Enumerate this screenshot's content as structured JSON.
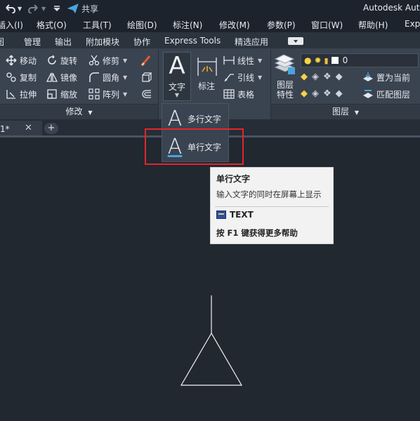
{
  "title_bar": {
    "share_label": "共享",
    "app_title": "Autodesk Auto"
  },
  "menu": {
    "items": [
      "插入(I)",
      "格式(O)",
      "工具(T)",
      "绘图(D)",
      "标注(N)",
      "修改(M)",
      "参数(P)",
      "窗口(W)",
      "帮助(H)",
      "Exp"
    ]
  },
  "ribbon_tabs": [
    "图",
    "管理",
    "输出",
    "附加模块",
    "协作",
    "Express Tools",
    "精选应用"
  ],
  "modify_panel": {
    "title": "修改",
    "tools": [
      "移动",
      "旋转",
      "修剪",
      "复制",
      "镜像",
      "圆角",
      "拉伸",
      "缩放",
      "阵列"
    ]
  },
  "annotation_panel": {
    "text_label": "文字",
    "dimension_label": "标注",
    "linear_label": "线性",
    "leader_label": "引线",
    "table_label": "表格"
  },
  "layers_panel": {
    "title": "图层",
    "properties_label": "图层\n特性",
    "current_layer": "0",
    "set_current_label": "置为当前",
    "match_layer_label": "匹配图层"
  },
  "text_dropdown": {
    "mtext_label": "多行文字",
    "single_text_label": "单行文字",
    "glyph": "A"
  },
  "doc_tabs": {
    "active_label": "1*",
    "close_glyph": "✕",
    "add_glyph": "+"
  },
  "tooltip": {
    "title": "单行文字",
    "description": "输入文字的同时在屏幕上显示",
    "command": "TEXT",
    "help": "按 F1 键获得更多帮助"
  },
  "colors": {
    "highlight": "#e3262a",
    "accent_blue": "#4aa3df",
    "canvas": "#212830",
    "ribbon": "#3a4350"
  }
}
